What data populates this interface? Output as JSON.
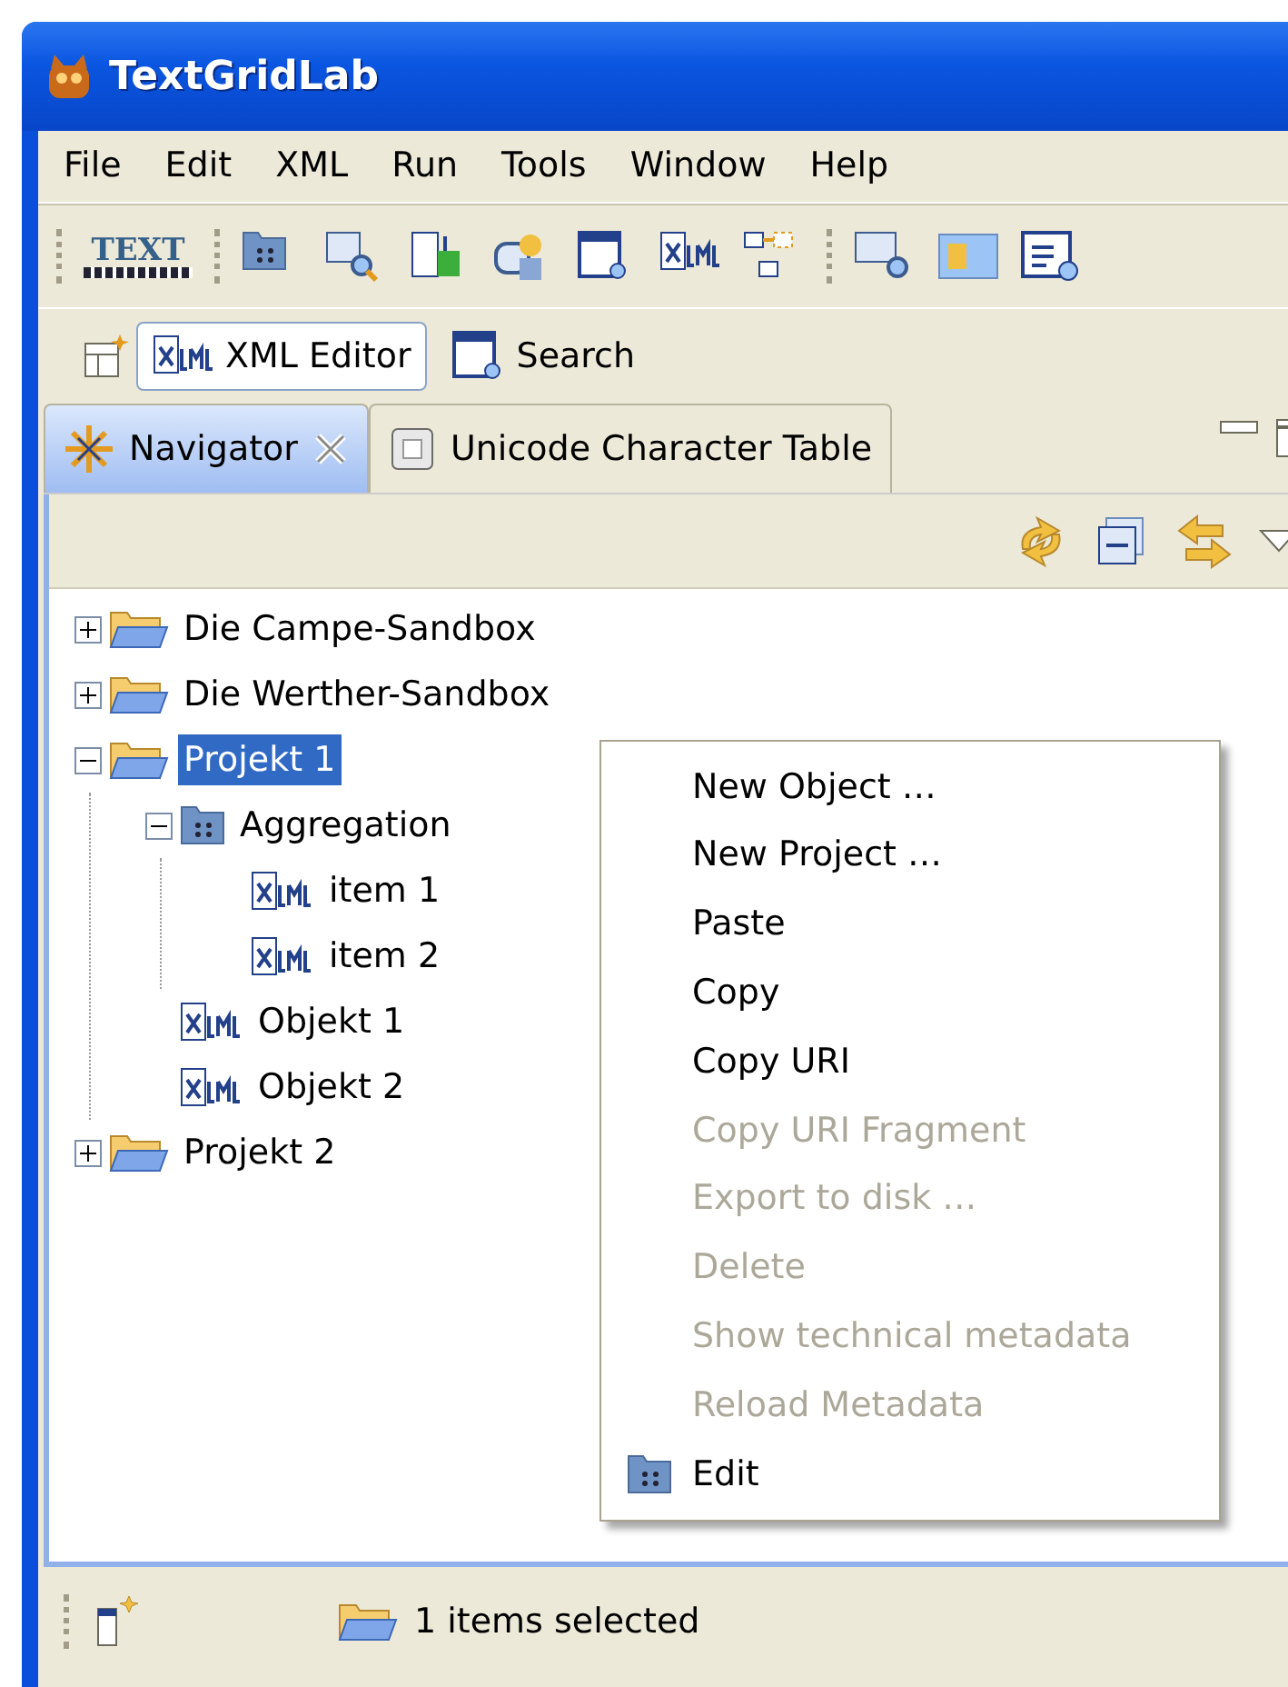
{
  "window": {
    "title": "TextGridLab"
  },
  "menu_bar": [
    "File",
    "Edit",
    "XML",
    "Run",
    "Tools",
    "Window",
    "Help"
  ],
  "toolbar": {
    "logo_text": "TEXT"
  },
  "perspectives": [
    {
      "label": "XML Editor",
      "selected": true
    },
    {
      "label": "Search",
      "selected": false
    }
  ],
  "view_tabs": [
    {
      "label": "Navigator",
      "selected": true
    },
    {
      "label": "Unicode Character Table",
      "selected": false
    }
  ],
  "tree": [
    {
      "label": "Die Campe-Sandbox",
      "kind": "folder",
      "expanded": false,
      "selected": false
    },
    {
      "label": "Die Werther-Sandbox",
      "kind": "folder",
      "expanded": false,
      "selected": false
    },
    {
      "label": "Projekt 1",
      "kind": "folder",
      "expanded": true,
      "selected": true,
      "children": [
        {
          "label": "Aggregation",
          "kind": "aggregation",
          "expanded": true,
          "selected": false,
          "children": [
            {
              "label": "item 1",
              "kind": "xml",
              "selected": false
            },
            {
              "label": "item 2",
              "kind": "xml",
              "selected": false
            }
          ]
        },
        {
          "label": "Objekt 1",
          "kind": "xml",
          "selected": false
        },
        {
          "label": "Objekt 2",
          "kind": "xml",
          "selected": false
        }
      ]
    },
    {
      "label": "Projekt 2",
      "kind": "folder",
      "expanded": false,
      "selected": false
    }
  ],
  "context_menu": [
    {
      "label": "New Object …",
      "disabled": false,
      "kind": "plain"
    },
    {
      "label": "New Project …",
      "disabled": false,
      "kind": "plain"
    },
    {
      "label": "Paste",
      "disabled": false,
      "kind": "plain"
    },
    {
      "label": "Copy",
      "disabled": false,
      "kind": "plain"
    },
    {
      "label": "Copy URI",
      "disabled": false,
      "kind": "plain"
    },
    {
      "label": "Copy URI Fragment",
      "disabled": true,
      "kind": "plain"
    },
    {
      "label": "Export to disk …",
      "disabled": true,
      "kind": "plain"
    },
    {
      "label": "Delete",
      "disabled": true,
      "kind": "plain"
    },
    {
      "label": "Show technical metadata",
      "disabled": true,
      "kind": "plain"
    },
    {
      "label": "Reload Metadata",
      "disabled": true,
      "kind": "plain"
    },
    {
      "label": "Edit",
      "disabled": false,
      "kind": "aggregation"
    }
  ],
  "status_bar": {
    "text": "1 items selected"
  }
}
